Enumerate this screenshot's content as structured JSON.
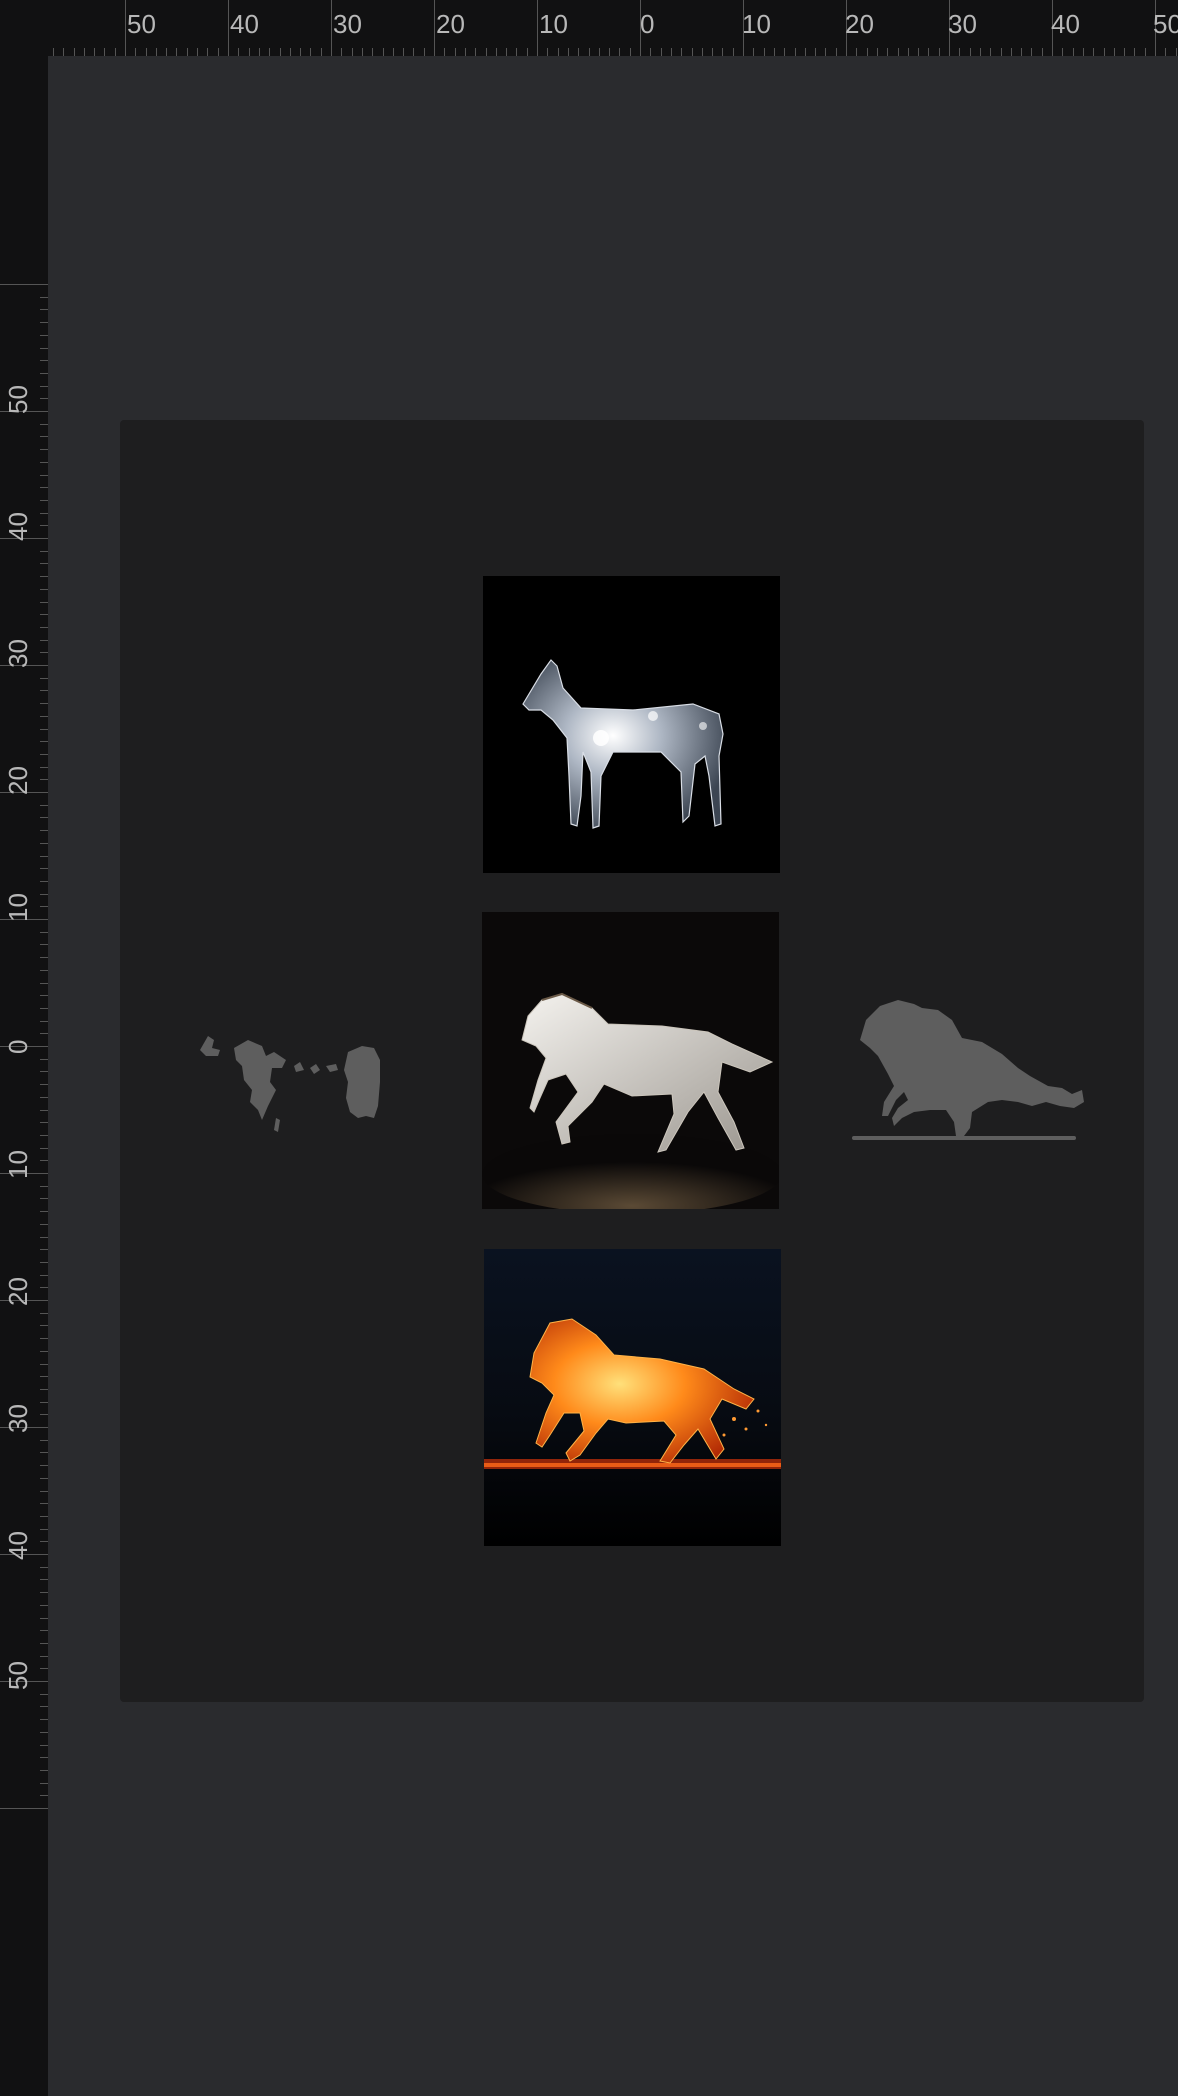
{
  "ruler": {
    "top_labels": [
      "50",
      "40",
      "30",
      "20",
      "10",
      "0",
      "10",
      "20",
      "30",
      "40",
      "50"
    ],
    "left_labels": [
      "50",
      "40",
      "30",
      "20",
      "10",
      "0",
      "10",
      "20",
      "30",
      "40",
      "50"
    ]
  },
  "canvas": {
    "background_color": "#2a2b2e",
    "artboard_color": "#1e1e1f",
    "silhouette_color": "#5e5e5e"
  },
  "images": [
    {
      "name": "crystal-horse-image",
      "subject": "glass horse standing"
    },
    {
      "name": "white-horse-image",
      "subject": "white horse galloping"
    },
    {
      "name": "fire-horse-image",
      "subject": "fire horse running"
    }
  ],
  "layers": [
    {
      "name": "map-shape-layer",
      "icon": "scattered-shape"
    },
    {
      "name": "horse-silhouette-layer",
      "icon": "horse-silhouette"
    }
  ]
}
